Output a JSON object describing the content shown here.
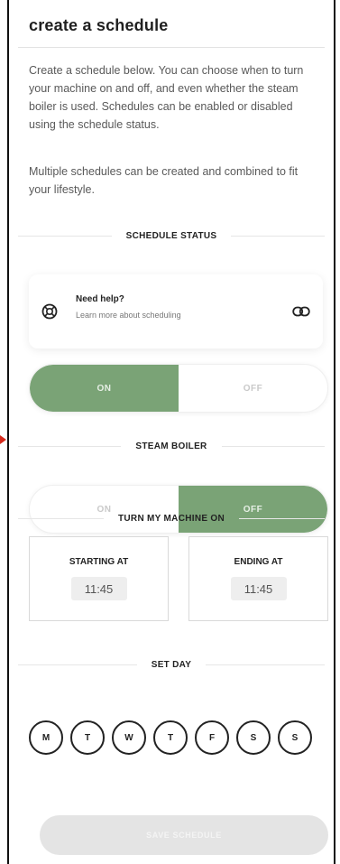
{
  "header": {
    "title": "create a schedule"
  },
  "intro": {
    "paragraph1": "Create a schedule below. You can choose when to turn your machine on and off, and even whether the steam boiler is used. Schedules can be enabled or disabled using the schedule status.",
    "paragraph2": "Multiple schedules can be created and combined to fit your lifestyle."
  },
  "schedule_status": {
    "heading": "SCHEDULE STATUS",
    "on_label": "ON",
    "off_label": "OFF",
    "selected": "ON"
  },
  "help": {
    "title": "Need help?",
    "subtitle": "Learn more about scheduling",
    "icon": "lifebuoy-icon",
    "link_icon": "link-icon"
  },
  "steam_boiler": {
    "heading": "STEAM BOILER",
    "on_label": "ON",
    "off_label": "OFF",
    "selected": "OFF"
  },
  "machine_on": {
    "heading": "TURN MY MACHINE ON",
    "starting_label": "STARTING AT",
    "starting_time": "11:45",
    "ending_label": "ENDING AT",
    "ending_time": "11:45"
  },
  "set_day": {
    "heading": "SET DAY",
    "days": [
      "M",
      "T",
      "W",
      "T",
      "F",
      "S",
      "S"
    ]
  },
  "save": {
    "label": "SAVE SCHEDULE"
  },
  "colors": {
    "accent": "#7aa376",
    "disabled_button": "#e4e4e4",
    "marker": "#d62a1c"
  }
}
